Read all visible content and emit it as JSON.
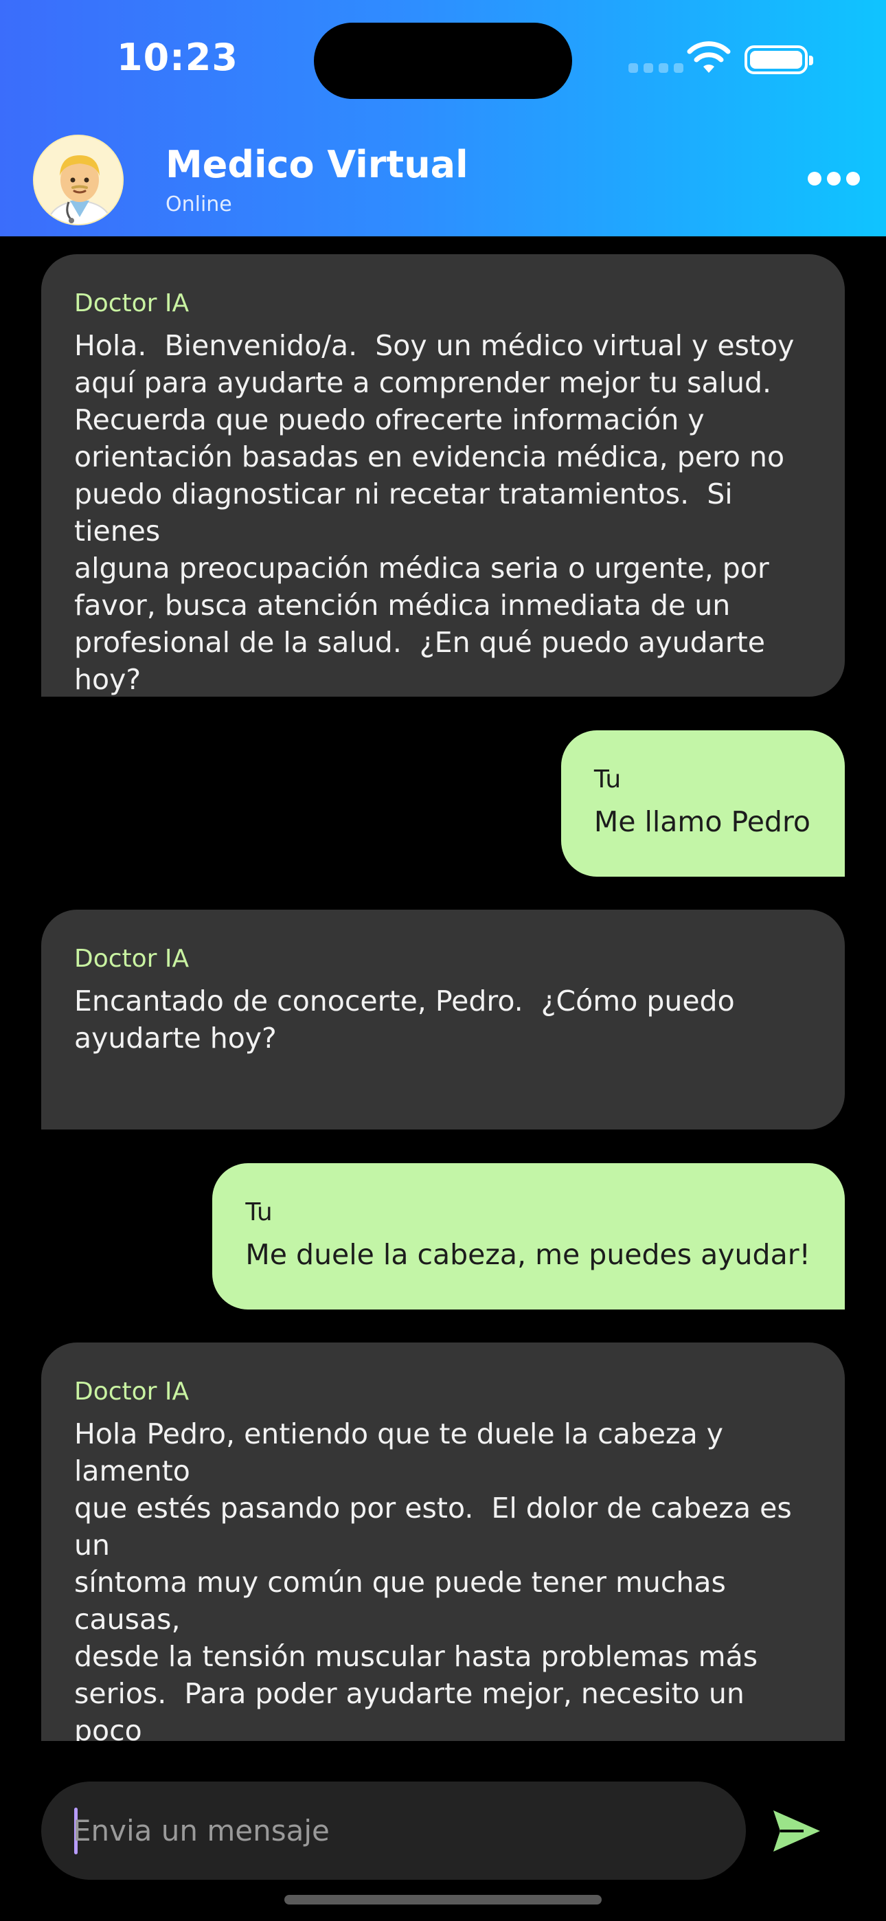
{
  "status_bar": {
    "time": "10:23"
  },
  "header": {
    "title": "Medico Virtual",
    "status": "Online",
    "avatar_icon": "doctor-emoji-icon",
    "menu_icon": "more-horizontal-icon"
  },
  "messages": [
    {
      "role": "bot",
      "sender": "Doctor IA",
      "text": "Hola.  Bienvenido/a.  Soy un médico virtual y estoy\naquí para ayudarte a comprender mejor tu salud.\nRecuerda que puedo ofrecerte información y\norientación basadas en evidencia médica, pero no\npuedo diagnosticar ni recetar tratamientos.  Si tienes\nalguna preocupación médica seria o urgente, por\nfavor, busca atención médica inmediata de un\nprofesional de la salud.  ¿En qué puedo ayudarte hoy?"
    },
    {
      "role": "user",
      "sender": "Tu",
      "text": "Me llamo Pedro"
    },
    {
      "role": "bot",
      "sender": "Doctor IA",
      "text": "Encantado de conocerte, Pedro.  ¿Cómo puedo\nayudarte hoy?"
    },
    {
      "role": "user",
      "sender": "Tu",
      "text": "Me duele la cabeza, me puedes ayudar!"
    },
    {
      "role": "bot",
      "sender": "Doctor IA",
      "text": "Hola Pedro, entiendo que te duele la cabeza y lamento\nque estés pasando por esto.  El dolor de cabeza es un\nsíntoma muy común que puede tener muchas causas,\ndesde la tensión muscular hasta problemas más\nserios.  Para poder ayudarte mejor, necesito un poco\nmás de información.\n\n¿Puedes describirme el dolor?  Por ejemplo:"
    }
  ],
  "composer": {
    "placeholder": "Envia un mensaje",
    "value": "",
    "send_icon": "send-icon"
  },
  "colors": {
    "header_gradient_start": "#3b6dfb",
    "header_gradient_end": "#0fc4ff",
    "bot_bubble": "#363636",
    "user_bubble": "#c3f5a7",
    "bot_sender": "#c9f3a2",
    "send_icon": "#9be489"
  }
}
